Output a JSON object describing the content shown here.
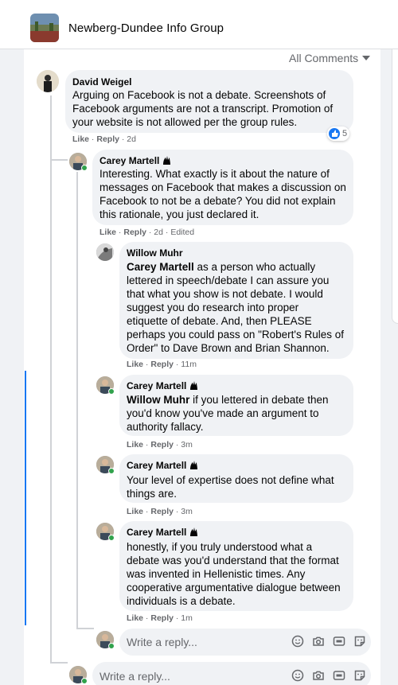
{
  "group": {
    "name": "Newberg-Dundee Info Group"
  },
  "sort": {
    "label": "All Comments"
  },
  "comments": [
    {
      "author": "David Weigel",
      "lines": [
        "Arguing on Facebook is not a debate. Screenshots of",
        "Facebook arguments are not a transcript. Promotion of",
        "your website is not allowed per the group rules."
      ],
      "like": "Like",
      "reply": "Reply",
      "time": "2d",
      "reaction_count": "5"
    },
    {
      "author": "Carey Martell",
      "lines": [
        "Interesting. What exactly is it about the nature of",
        "messages on Facebook that makes a discussion on",
        "Facebook to not be a debate? You did not explain",
        "this rationale, you just declared it."
      ],
      "like": "Like",
      "reply": "Reply",
      "time": "2d",
      "edited": "Edited"
    },
    {
      "author": "Willow Muhr",
      "mention": "Carey Martell",
      "first_line_rest": " as a person who actually",
      "lines": [
        "lettered in speech/debate I can assure you",
        "that what you show is not debate. I would",
        "suggest you do research into proper",
        "etiquette of debate. And, then PLEASE",
        "perhaps you could pass on \"Robert's Rules of",
        "Order\" to Dave Brown and Brian Shannon."
      ],
      "like": "Like",
      "reply": "Reply",
      "time": "11m"
    },
    {
      "author": "Carey Martell",
      "mention": "Willow Muhr",
      "first_line_rest": " if you lettered in debate then",
      "lines": [
        "you'd know you've made an argument to",
        "authority fallacy."
      ],
      "like": "Like",
      "reply": "Reply",
      "time": "3m"
    },
    {
      "author": "Carey Martell",
      "lines": [
        "Your level of expertise does not define what",
        "things are."
      ],
      "like": "Like",
      "reply": "Reply",
      "time": "3m"
    },
    {
      "author": "Carey Martell",
      "lines": [
        "honestly, if you truly understood what a",
        "debate was you'd understand that the format",
        "was invented in Hellenistic times. Any",
        "cooperative argumentative dialogue between",
        "individuals is a debate."
      ],
      "like": "Like",
      "reply": "Reply",
      "time": "1m"
    }
  ],
  "composer": {
    "nested_placeholder": "Write a reply...",
    "top_placeholder": "Write a reply..."
  },
  "colors": {
    "link": "#1877f2",
    "muted": "#65676b",
    "online": "#31a24c",
    "bubble": "#f0f2f5"
  }
}
